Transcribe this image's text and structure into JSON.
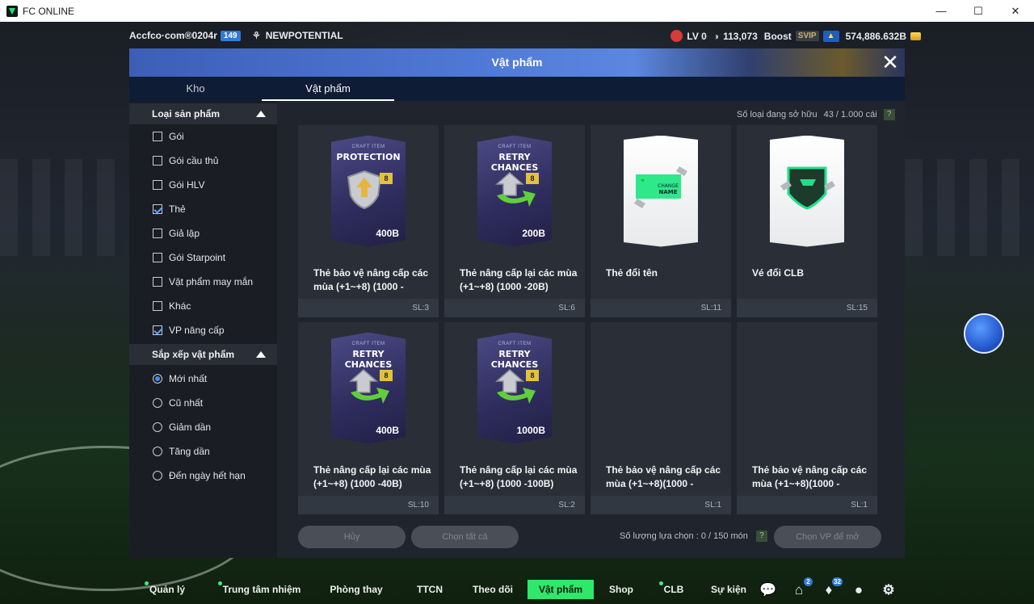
{
  "window": {
    "title": "FC ONLINE"
  },
  "topbar": {
    "account": "Accfco·com®0204r",
    "account_level": "149",
    "team": "NEWPOTENTIAL",
    "lv": "LV 0",
    "points": "113,073",
    "boost_label": "Boost",
    "svip": "SVIP",
    "bp": "574,886.632B"
  },
  "modal": {
    "title": "Vật phẩm",
    "tabs": [
      {
        "label": "Kho"
      },
      {
        "label": "Vật phẩm"
      }
    ],
    "owned_label": "Số loại đang sở hữu",
    "owned_value": "43 / 1.000 cái",
    "filter_title": "Loại sản phẩm",
    "filters": [
      {
        "label": "Gói",
        "checked": false
      },
      {
        "label": "Gói cầu thủ",
        "checked": false
      },
      {
        "label": "Gói HLV",
        "checked": false
      },
      {
        "label": "Thẻ",
        "checked": true
      },
      {
        "label": "Giả lập",
        "checked": false
      },
      {
        "label": "Gói Starpoint",
        "checked": false
      },
      {
        "label": "Vật phẩm may mắn",
        "checked": false
      },
      {
        "label": "Khác",
        "checked": false
      },
      {
        "label": "VP nâng cấp",
        "checked": true
      }
    ],
    "sort_title": "Sắp xếp vật phẩm",
    "sorts": [
      {
        "label": "Mới nhất",
        "selected": true
      },
      {
        "label": "Cũ nhất",
        "selected": false
      },
      {
        "label": "Giảm dần",
        "selected": false
      },
      {
        "label": "Tăng dần",
        "selected": false
      },
      {
        "label": "Đến ngày hết hạn",
        "selected": false
      }
    ],
    "items": [
      {
        "kind": "craft",
        "small": "CRAFT ITEM",
        "big": "PROTECTION",
        "lvl": "8",
        "price": "400B",
        "icon": "shield-icon",
        "name": "Thẻ bảo vệ nâng cấp các mùa (+1~+8) (1000 -",
        "qty": "SL:3"
      },
      {
        "kind": "craft",
        "small": "CRAFT ITEM",
        "big": "RETRY CHANCES",
        "lvl": "8",
        "price": "200B",
        "icon": "retry-arrows-icon",
        "name": "Thẻ nâng cấp lại các mùa (+1~+8) (1000 -20B)",
        "qty": "SL:6"
      },
      {
        "kind": "white",
        "label": "CHANGE NAME",
        "icon": "change-name-icon",
        "name": "Thẻ đổi tên",
        "qty": "SL:11"
      },
      {
        "kind": "white",
        "label": "",
        "icon": "club-crest-icon",
        "name": "Vé đổi CLB",
        "qty": "SL:15"
      },
      {
        "kind": "craft",
        "small": "CRAFT ITEM",
        "big": "RETRY CHANCES",
        "lvl": "8",
        "price": "400B",
        "icon": "retry-arrows-icon",
        "name": "Thẻ nâng cấp lại các mùa (+1~+8) (1000 -40B)",
        "qty": "SL:10"
      },
      {
        "kind": "craft",
        "small": "CRAFT ITEM",
        "big": "RETRY CHANCES",
        "lvl": "8",
        "price": "1000B",
        "icon": "retry-arrows-icon",
        "name": "Thẻ nâng cấp lại các mùa (+1~+8) (1000 -100B)",
        "qty": "SL:2"
      },
      {
        "kind": "empty",
        "name": "Thẻ bảo vệ nâng cấp các mùa (+1~+8)(1000 -",
        "qty": "SL:1"
      },
      {
        "kind": "empty",
        "name": "Thẻ bảo vệ nâng cấp các mùa (+1~+8)(1000 -",
        "qty": "SL:1"
      }
    ],
    "cancel_label": "Hủy",
    "select_all_label": "Chọn tất cả",
    "selected_label": "Số lượng lựa chọn : 0 / 150 món",
    "choose_label": "Chọn VP để mở"
  },
  "nav": [
    {
      "label": "Quản lý CT",
      "dot": true
    },
    {
      "label": "Trung tâm nhiệm vụ",
      "dot": true
    },
    {
      "label": "Phòng thay đồ",
      "dot": false
    },
    {
      "label": "TTCN",
      "dot": false
    },
    {
      "label": "Theo dõi",
      "dot": false
    },
    {
      "label": "Vật phẩm",
      "dot": false,
      "active": true
    },
    {
      "label": "Shop",
      "dot": false
    },
    {
      "label": "CLB",
      "dot": true
    },
    {
      "label": "Sự kiện",
      "dot": false
    }
  ],
  "nav_badges": {
    "home": "2",
    "bell": "32"
  },
  "colors": {
    "accent_green": "#2ee86a",
    "header_blue": "#4f79d6",
    "level_blue": "#2f7bd8"
  }
}
